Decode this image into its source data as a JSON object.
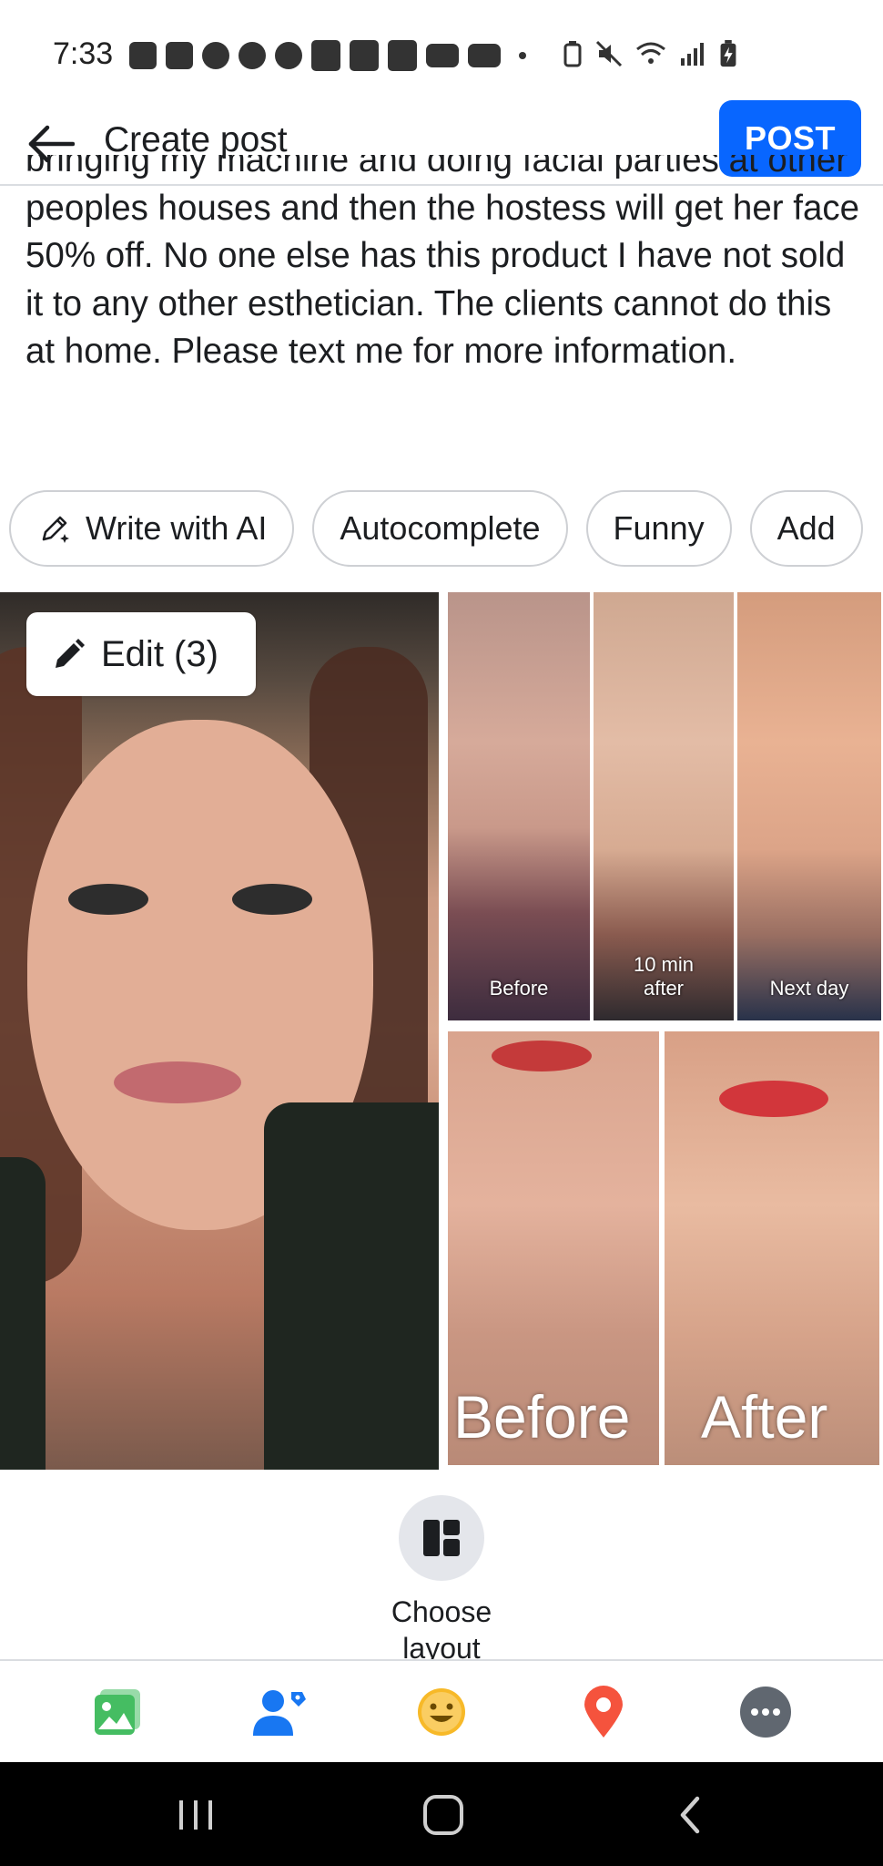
{
  "status_bar": {
    "time": "7:33"
  },
  "header": {
    "title": "Create post",
    "post_label": "POST",
    "accent_color": "#0866ff"
  },
  "post": {
    "text": "bringing my machine and doing facial parties at other peoples houses and then the hostess will get her face 50% off. No one else has this product I have not sold it to any other esthetician. The clients cannot do this at home. Please text me for more information."
  },
  "chips": [
    {
      "label": "Write with AI",
      "icon": "pencil-sparkle-icon"
    },
    {
      "label": "Autocomplete"
    },
    {
      "label": "Funny"
    },
    {
      "label": "Add"
    }
  ],
  "photos": {
    "edit_label": "Edit (3)",
    "top_labels": [
      "Before",
      "10 min after",
      "Next day"
    ],
    "bottom_labels": [
      "Before",
      "After"
    ]
  },
  "layout": {
    "label": "Choose layout"
  },
  "toolbar": {
    "items": [
      {
        "name": "photo-icon",
        "color": "#45bd62"
      },
      {
        "name": "tag-people-icon",
        "color": "#1877f2"
      },
      {
        "name": "feeling-icon",
        "color": "#f7b928"
      },
      {
        "name": "location-icon",
        "color": "#f5533d"
      },
      {
        "name": "more-icon",
        "color": "#606770"
      }
    ]
  }
}
